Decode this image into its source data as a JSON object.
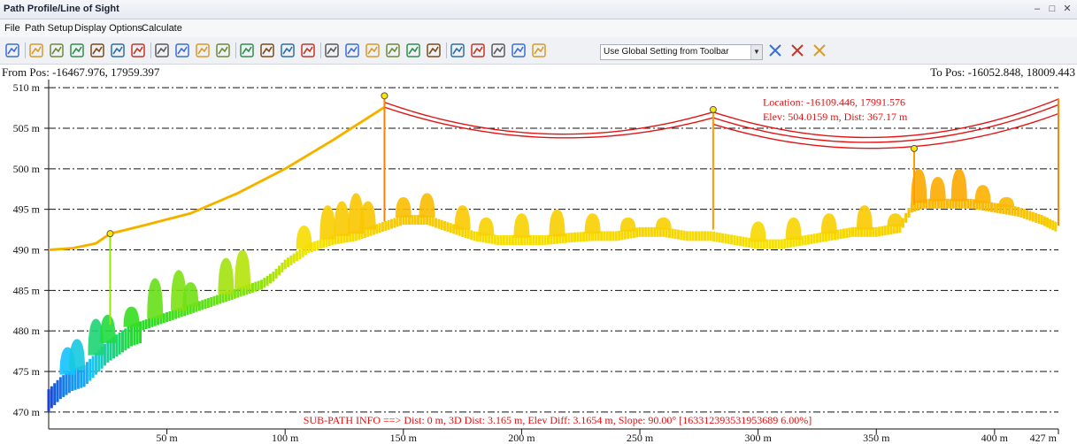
{
  "window": {
    "title": "Path Profile/Line of Sight",
    "controls": [
      "–",
      "□",
      "✕"
    ]
  },
  "menu": [
    "File",
    "Path Setup",
    "Display Options",
    "Calculate"
  ],
  "toolbar": {
    "buttons": [
      "zoom-icon",
      "pan-hand-icon",
      "ruler-icon",
      "select-points-icon",
      "select-area-icon",
      "measure-icon",
      "profile-icon",
      "pointer-icon",
      "line-tool-icon",
      "terrain-icon",
      "ground-icon",
      "tree-icon",
      "view-eye-icon",
      "los-icon",
      "path-left-icon",
      "path-right-icon",
      "mountain-icon",
      "grass-icon",
      "bush-icon",
      "tree-green-icon",
      "building-icon",
      "pole-icon",
      "power-line-icon",
      "water-icon",
      "water-wave-icon",
      "key-icon"
    ],
    "combo_value": "Use Global Setting from Toolbar",
    "right_buttons": [
      "settings-icon",
      "clear-icon",
      "filter-icon"
    ]
  },
  "position": {
    "from": "From Pos: -16467.976, 17959.397",
    "to": "To Pos: -16052.848, 18009.443"
  },
  "chart_data": {
    "type": "scatter",
    "title": "",
    "xlabel": "",
    "ylabel": "",
    "xlim": [
      0,
      427
    ],
    "ylim": [
      469,
      511
    ],
    "x_ticks": [
      {
        "value": 50,
        "label": "50 m"
      },
      {
        "value": 100,
        "label": "100 m"
      },
      {
        "value": 150,
        "label": "150 m"
      },
      {
        "value": 200,
        "label": "200 m"
      },
      {
        "value": 250,
        "label": "250 m"
      },
      {
        "value": 300,
        "label": "300 m"
      },
      {
        "value": 350,
        "label": "350 m"
      },
      {
        "value": 400,
        "label": "400 m"
      },
      {
        "value": 427,
        "label": "427 m"
      }
    ],
    "y_ticks": [
      {
        "value": 470,
        "label": "470 m"
      },
      {
        "value": 475,
        "label": "475 m"
      },
      {
        "value": 480,
        "label": "480 m"
      },
      {
        "value": 485,
        "label": "485 m"
      },
      {
        "value": 490,
        "label": "490 m"
      },
      {
        "value": 495,
        "label": "495 m"
      },
      {
        "value": 500,
        "label": "500 m"
      },
      {
        "value": 505,
        "label": "505 m"
      },
      {
        "value": 510,
        "label": "510 m"
      }
    ],
    "grid": true,
    "color_scale": [
      "#1a2fd0",
      "#13c7ff",
      "#22dd22",
      "#f5e600",
      "#ff9900",
      "#e21515"
    ],
    "ground_profile": {
      "x": [
        0,
        5,
        10,
        15,
        20,
        25,
        30,
        35,
        40,
        45,
        50,
        55,
        60,
        65,
        70,
        75,
        80,
        85,
        90,
        95,
        100,
        105,
        110,
        115,
        120,
        130,
        140,
        150,
        160,
        170,
        180,
        190,
        200,
        210,
        220,
        230,
        240,
        250,
        260,
        270,
        280,
        290,
        300,
        310,
        320,
        330,
        340,
        350,
        360,
        365,
        370,
        380,
        390,
        400,
        410,
        420,
        427
      ],
      "y": [
        472.5,
        474,
        475,
        475.5,
        477,
        478.5,
        479.5,
        480.5,
        481,
        481.5,
        482,
        482.5,
        483,
        483.5,
        484,
        484.5,
        485,
        485.5,
        486,
        487,
        488.5,
        489.5,
        490.5,
        491,
        491.5,
        492,
        493,
        494,
        494,
        493,
        492,
        491.5,
        491.5,
        491.5,
        491.8,
        492,
        492,
        492.5,
        492.5,
        492,
        492,
        491.5,
        491,
        491,
        491.5,
        492,
        492.5,
        492.5,
        493,
        495.5,
        496,
        496,
        496,
        495.5,
        495,
        494,
        493
      ]
    },
    "vegetation": [
      {
        "x": 8,
        "h": 478
      },
      {
        "x": 12,
        "h": 479
      },
      {
        "x": 20,
        "h": 481.5
      },
      {
        "x": 25,
        "h": 482
      },
      {
        "x": 35,
        "h": 483
      },
      {
        "x": 45,
        "h": 486.5
      },
      {
        "x": 55,
        "h": 487.5
      },
      {
        "x": 60,
        "h": 486
      },
      {
        "x": 75,
        "h": 489
      },
      {
        "x": 82,
        "h": 490
      },
      {
        "x": 108,
        "h": 493
      },
      {
        "x": 118,
        "h": 495.5
      },
      {
        "x": 124,
        "h": 496
      },
      {
        "x": 130,
        "h": 497
      },
      {
        "x": 135,
        "h": 496
      },
      {
        "x": 150,
        "h": 496.5
      },
      {
        "x": 160,
        "h": 497
      },
      {
        "x": 175,
        "h": 495.5
      },
      {
        "x": 185,
        "h": 494
      },
      {
        "x": 200,
        "h": 494.5
      },
      {
        "x": 215,
        "h": 495
      },
      {
        "x": 230,
        "h": 494.5
      },
      {
        "x": 245,
        "h": 494
      },
      {
        "x": 260,
        "h": 494
      },
      {
        "x": 300,
        "h": 493.5
      },
      {
        "x": 315,
        "h": 494
      },
      {
        "x": 330,
        "h": 494.5
      },
      {
        "x": 345,
        "h": 495.5
      },
      {
        "x": 358,
        "h": 494.5
      },
      {
        "x": 368,
        "h": 500
      },
      {
        "x": 376,
        "h": 499
      },
      {
        "x": 385,
        "h": 500
      },
      {
        "x": 395,
        "h": 498
      },
      {
        "x": 405,
        "h": 496.5
      }
    ],
    "poles": [
      {
        "x": 26,
        "top": 492,
        "base": 480.8
      },
      {
        "x": 142,
        "top": 509,
        "base": 493.5
      },
      {
        "x": 281,
        "top": 507.3,
        "base": 492.5
      },
      {
        "x": 366,
        "top": 502.5,
        "base": 495.5
      },
      {
        "x": 427,
        "top": 508.7,
        "base": 493
      }
    ],
    "wire_low": {
      "x": [
        0,
        10,
        20,
        26,
        40,
        60,
        80,
        100,
        120,
        142
      ],
      "y": [
        490,
        490.2,
        490.8,
        492,
        493,
        494.5,
        497,
        500,
        503.5,
        507.6
      ]
    },
    "wire_spans": [
      {
        "x0": 142,
        "x1": 281,
        "y0": 508.2,
        "y1": 507.0,
        "sag": 3.3
      },
      {
        "x0": 142,
        "x1": 281,
        "y0": 507.6,
        "y1": 506.3,
        "sag": 3.1
      },
      {
        "x0": 281,
        "x1": 427,
        "y0": 507.0,
        "y1": 508.6,
        "sag": 3.9
      },
      {
        "x0": 281,
        "x1": 427,
        "y0": 506.3,
        "y1": 507.9,
        "sag": 3.8
      },
      {
        "x0": 281,
        "x1": 427,
        "y0": 505.5,
        "y1": 506.8,
        "sag": 3.6
      }
    ],
    "annotations": [
      {
        "text": "Location: -16109.446, 17991.576",
        "x": 302,
        "y": 507.8
      },
      {
        "text": "Elev: 504.0159 m, Dist: 367.17 m",
        "x": 302,
        "y": 506.0
      }
    ],
    "subpath_info": "SUB-PATH INFO ==> Dist: 0 m, 3D Dist: 3.165 m, Elev Diff: 3.1654 m, Slope: 90.00° [163312393531953689 6.00%]"
  }
}
